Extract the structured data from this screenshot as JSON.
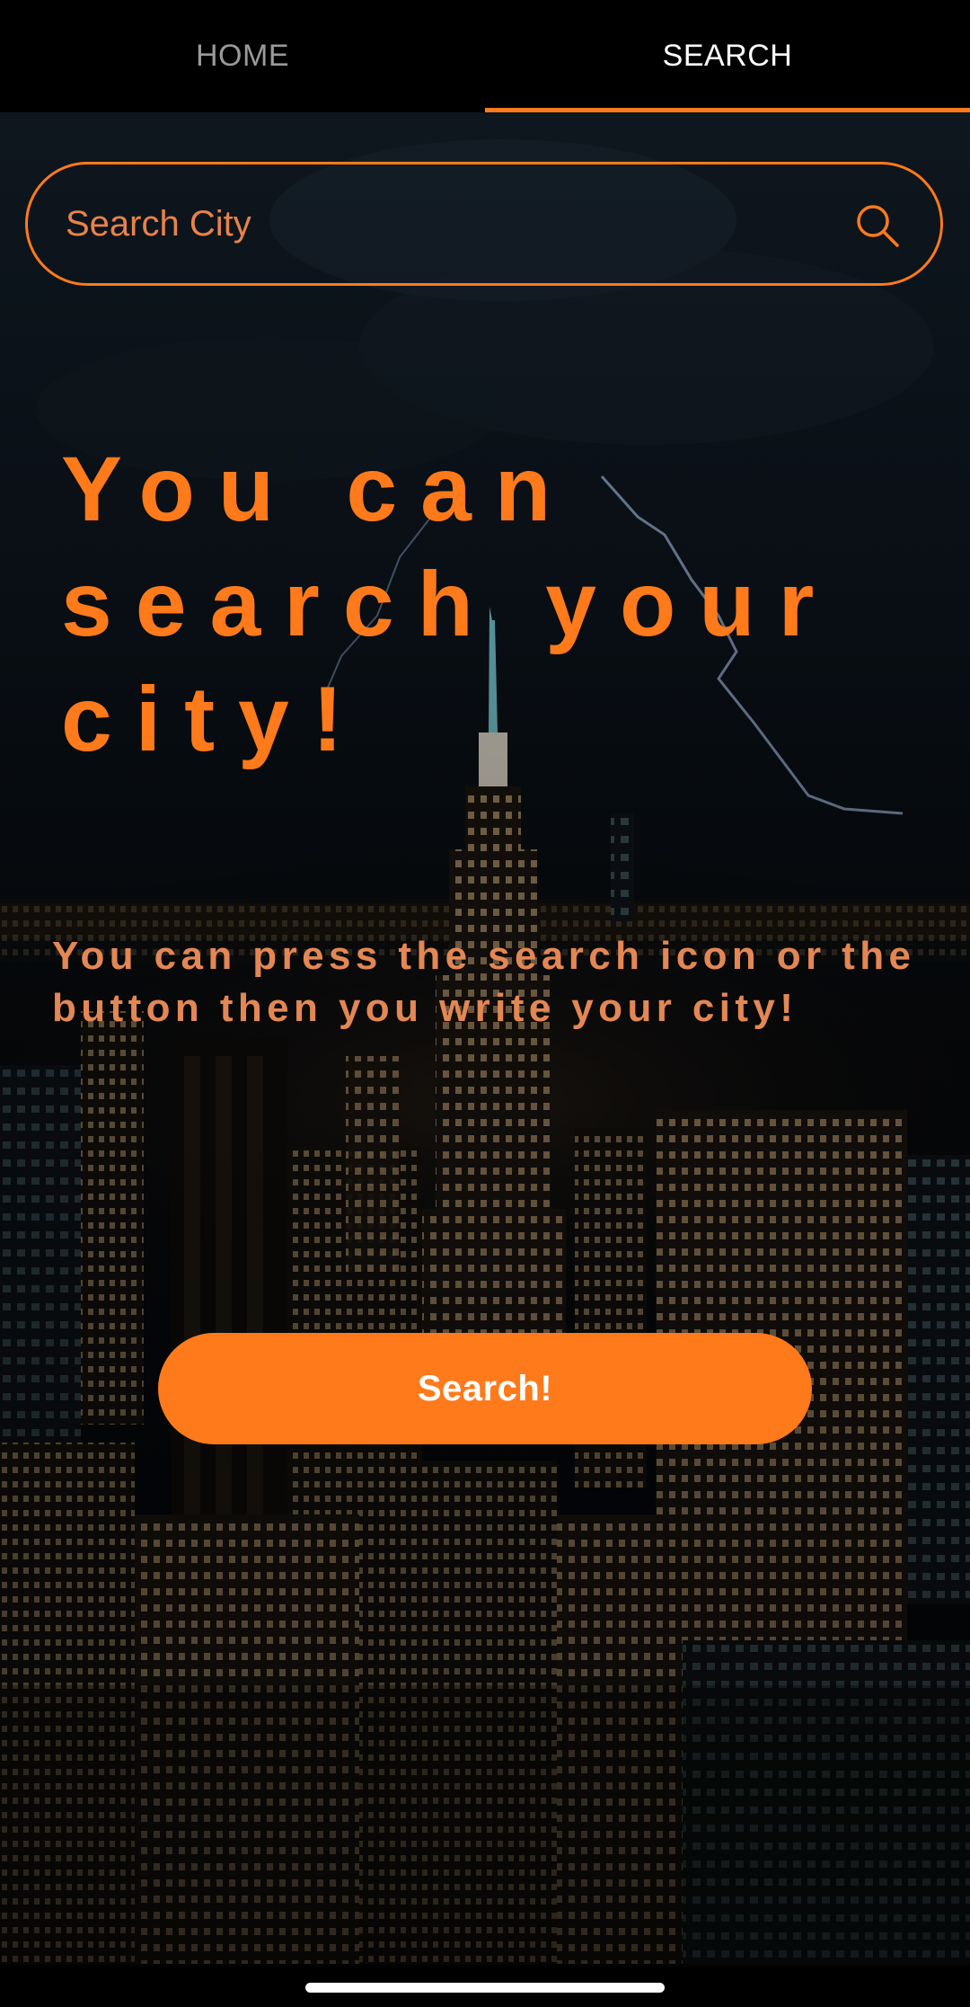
{
  "tabs": {
    "home_label": "HOME",
    "search_label": "SEARCH",
    "active": "SEARCH"
  },
  "search": {
    "placeholder": "Search City",
    "icon": "search-icon"
  },
  "content": {
    "headline": "You can search your city!",
    "subline": "You can press the search icon or the button then you write your city!",
    "button_label": "Search!"
  },
  "colors": {
    "accent": "#ff7a1a",
    "subtext": "#e38754",
    "background": "#000000"
  }
}
